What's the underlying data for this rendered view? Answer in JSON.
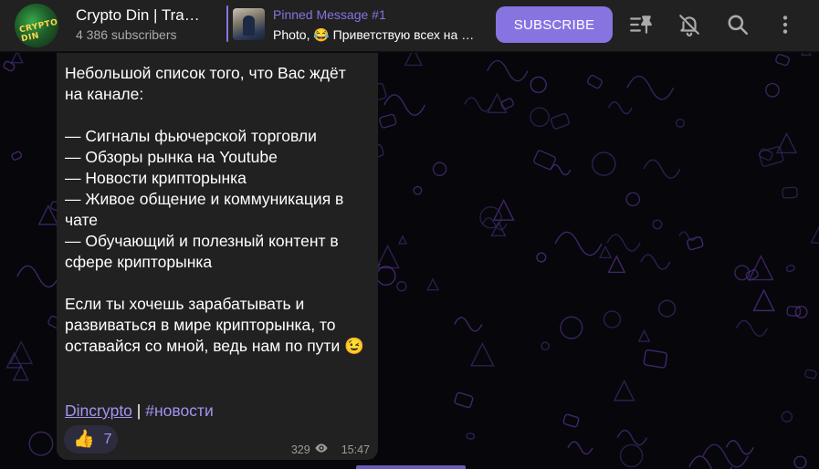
{
  "header": {
    "title": "Crypto Din | Trading",
    "subscribers": "4 386 subscribers",
    "avatar_text": "CRYPTO DIN",
    "pinned": {
      "title": "Pinned Message #1",
      "text": "Photo, 😂 Приветствую всех на канале"
    },
    "subscribe_label": "SUBSCRIBE",
    "icons": [
      "pinned-list-icon",
      "bell-off-icon",
      "search-icon",
      "more-vert-icon"
    ]
  },
  "message": {
    "body": "Небольшой список того, что Вас ждёт на канале:\n\n— Сигналы фьючерской торговли\n— Обзоры рынка на Youtube\n— Новости крипторынка\n— Живое общение и коммуникация в чате\n— Обучающий и полезный контент в сфере крипторынка\n\nЕсли ты хочешь зарабатывать и развиваться в мире крипторынка, то оставайся со мной, ведь нам по пути 😉",
    "link_user": "Dincrypto",
    "separator": "|",
    "hashtag": "#новости",
    "reaction": {
      "emoji": "👍",
      "count": "7"
    },
    "views": "329",
    "time": "15:47"
  },
  "colors": {
    "accent": "#8774e1",
    "header_bg": "#212121",
    "bubble_bg": "#212121",
    "chat_bg": "#07060a"
  }
}
